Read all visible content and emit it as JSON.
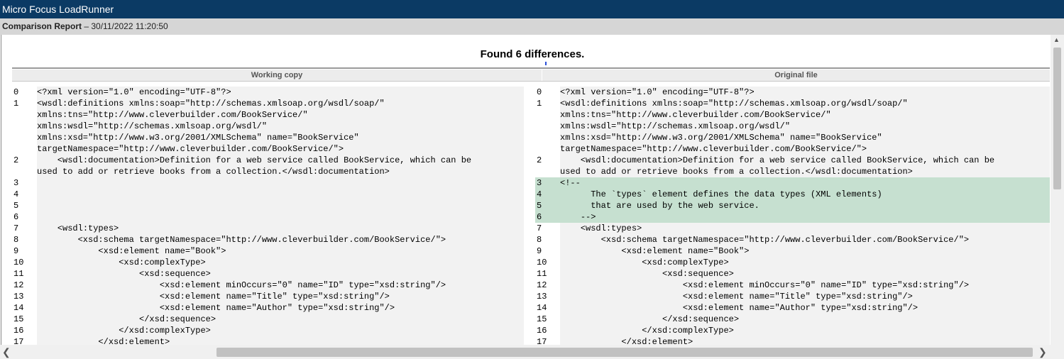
{
  "window": {
    "title": "Micro Focus LoadRunner"
  },
  "report": {
    "label": "Comparison Report",
    "separator": " – ",
    "timestamp": "30/11/2022 11:20:50"
  },
  "summary": {
    "heading": "Found 6 differences."
  },
  "columns": {
    "left": "Working copy",
    "right": "Original file"
  },
  "left_rows": [
    {
      "n": "0",
      "t": "<?xml version=\"1.0\" encoding=\"UTF-8\"?>"
    },
    {
      "n": "1",
      "t": "<wsdl:definitions xmlns:soap=\"http://schemas.xmlsoap.org/wsdl/soap/\"\nxmlns:tns=\"http://www.cleverbuilder.com/BookService/\"\nxmlns:wsdl=\"http://schemas.xmlsoap.org/wsdl/\"\nxmlns:xsd=\"http://www.w3.org/2001/XMLSchema\" name=\"BookService\"\ntargetNamespace=\"http://www.cleverbuilder.com/BookService/\">"
    },
    {
      "n": "2",
      "t": "    <wsdl:documentation>Definition for a web service called BookService, which can be\nused to add or retrieve books from a collection.</wsdl:documentation>"
    },
    {
      "n": "3",
      "t": ""
    },
    {
      "n": "4",
      "t": ""
    },
    {
      "n": "5",
      "t": ""
    },
    {
      "n": "6",
      "t": ""
    },
    {
      "n": "7",
      "t": "    <wsdl:types>"
    },
    {
      "n": "8",
      "t": "        <xsd:schema targetNamespace=\"http://www.cleverbuilder.com/BookService/\">"
    },
    {
      "n": "9",
      "t": "            <xsd:element name=\"Book\">"
    },
    {
      "n": "10",
      "t": "                <xsd:complexType>"
    },
    {
      "n": "11",
      "t": "                    <xsd:sequence>"
    },
    {
      "n": "12",
      "t": "                        <xsd:element minOccurs=\"0\" name=\"ID\" type=\"xsd:string\"/>"
    },
    {
      "n": "13",
      "t": "                        <xsd:element name=\"Title\" type=\"xsd:string\"/>"
    },
    {
      "n": "14",
      "t": "                        <xsd:element name=\"Author\" type=\"xsd:string\"/>"
    },
    {
      "n": "15",
      "t": "                    </xsd:sequence>"
    },
    {
      "n": "16",
      "t": "                </xsd:complexType>"
    },
    {
      "n": "17",
      "t": "            </xsd:element>"
    }
  ],
  "right_rows": [
    {
      "n": "0",
      "t": "<?xml version=\"1.0\" encoding=\"UTF-8\"?>"
    },
    {
      "n": "1",
      "t": "<wsdl:definitions xmlns:soap=\"http://schemas.xmlsoap.org/wsdl/soap/\"\nxmlns:tns=\"http://www.cleverbuilder.com/BookService/\"\nxmlns:wsdl=\"http://schemas.xmlsoap.org/wsdl/\"\nxmlns:xsd=\"http://www.w3.org/2001/XMLSchema\" name=\"BookService\"\ntargetNamespace=\"http://www.cleverbuilder.com/BookService/\">"
    },
    {
      "n": "2",
      "t": "    <wsdl:documentation>Definition for a web service called BookService, which can be\nused to add or retrieve books from a collection.</wsdl:documentation>"
    },
    {
      "n": "3",
      "t": "<!--",
      "diff": true
    },
    {
      "n": "4",
      "t": "      The `types` element defines the data types (XML elements)",
      "diff": true
    },
    {
      "n": "5",
      "t": "      that are used by the web service.",
      "diff": true
    },
    {
      "n": "6",
      "t": "    -->",
      "diff": true
    },
    {
      "n": "7",
      "t": "    <wsdl:types>"
    },
    {
      "n": "8",
      "t": "        <xsd:schema targetNamespace=\"http://www.cleverbuilder.com/BookService/\">"
    },
    {
      "n": "9",
      "t": "            <xsd:element name=\"Book\">"
    },
    {
      "n": "10",
      "t": "                <xsd:complexType>"
    },
    {
      "n": "11",
      "t": "                    <xsd:sequence>"
    },
    {
      "n": "12",
      "t": "                        <xsd:element minOccurs=\"0\" name=\"ID\" type=\"xsd:string\"/>"
    },
    {
      "n": "13",
      "t": "                        <xsd:element name=\"Title\" type=\"xsd:string\"/>"
    },
    {
      "n": "14",
      "t": "                        <xsd:element name=\"Author\" type=\"xsd:string\"/>"
    },
    {
      "n": "15",
      "t": "                    </xsd:sequence>"
    },
    {
      "n": "16",
      "t": "                </xsd:complexType>"
    },
    {
      "n": "17",
      "t": "            </xsd:element>"
    }
  ],
  "colors": {
    "titlebar": "#0b3a64",
    "diff_highlight": "#c6e0d0",
    "code_bg": "#f2f2f2"
  },
  "icons": {
    "scroll_left": "chevron-left-icon",
    "scroll_right": "chevron-right-icon",
    "scroll_up": "chevron-up-icon"
  }
}
